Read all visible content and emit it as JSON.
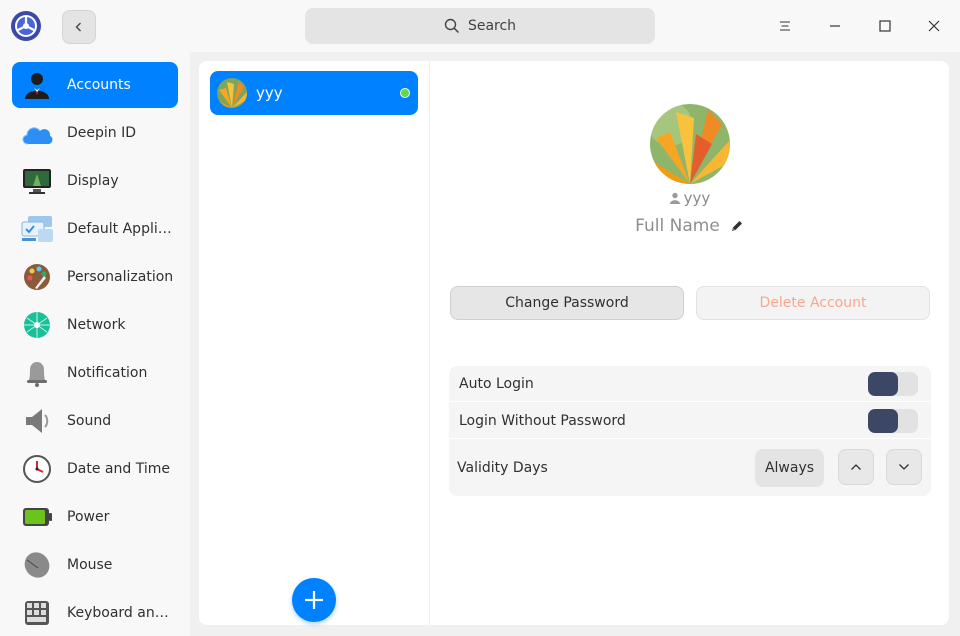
{
  "header": {
    "search_placeholder": "Search"
  },
  "sidebar": {
    "items": [
      {
        "label": "Accounts",
        "icon": "accounts-icon"
      },
      {
        "label": "Deepin ID",
        "icon": "cloud-icon"
      },
      {
        "label": "Display",
        "icon": "display-icon"
      },
      {
        "label": "Default Applic...",
        "icon": "default-apps-icon"
      },
      {
        "label": "Personalization",
        "icon": "palette-icon"
      },
      {
        "label": "Network",
        "icon": "network-icon"
      },
      {
        "label": "Notification",
        "icon": "bell-icon"
      },
      {
        "label": "Sound",
        "icon": "speaker-icon"
      },
      {
        "label": "Date and Time",
        "icon": "clock-icon"
      },
      {
        "label": "Power",
        "icon": "battery-icon"
      },
      {
        "label": "Mouse",
        "icon": "mouse-icon"
      },
      {
        "label": "Keyboard and ...",
        "icon": "keyboard-icon"
      }
    ]
  },
  "users": [
    {
      "name": "yyy",
      "online": true
    }
  ],
  "detail": {
    "account_name": "yyy",
    "full_name": "Full Name",
    "change_password": "Change Password",
    "delete_account": "Delete Account",
    "auto_login": {
      "label": "Auto Login",
      "on": false
    },
    "login_without_password": {
      "label": "Login Without Password",
      "on": false
    },
    "validity_days": {
      "label": "Validity Days",
      "value": "Always"
    }
  },
  "colors": {
    "accent": "#0081ff",
    "online": "#64d64a",
    "delete_text": "#f7a78d",
    "toggle_knob": "#3c4766"
  }
}
